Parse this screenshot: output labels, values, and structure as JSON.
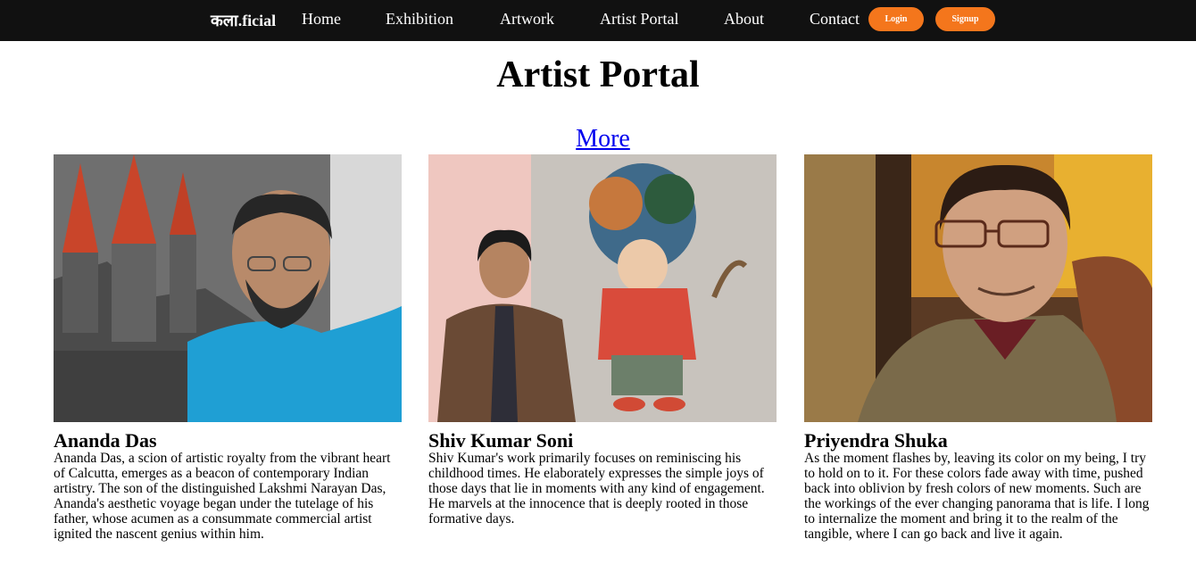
{
  "nav": {
    "brand": "कला.ficial",
    "links": [
      "Home",
      "Exhibition",
      "Artwork",
      "Artist Portal",
      "About",
      "Contact"
    ],
    "login_label": "Login",
    "signup_label": "Signup",
    "accent_color": "#f4761c"
  },
  "page": {
    "title": "Artist Portal",
    "more_label": "More"
  },
  "artists": [
    {
      "name": "Ananda Das",
      "bio": "Ananda Das, a scion of artistic royalty from the vibrant heart of Calcutta, emerges as a beacon of contemporary Indian artistry. The son of the distinguished Lakshmi Narayan Das, Ananda's aesthetic voyage began under the tutelage of his father, whose acumen as a consummate commercial artist ignited the nascent genius within him."
    },
    {
      "name": "Shiv Kumar Soni",
      "bio": "Shiv Kumar's work primarily focuses on reminiscing his childhood times. He elaborately expresses the simple joys of those days that lie in moments with any kind of engagement. He marvels at the innocence that is deeply rooted in those formative days."
    },
    {
      "name": "Priyendra Shuka",
      "bio": "As the moment flashes by, leaving its color on my being, I try to hold on to it. For these colors fade away with time, pushed back into oblivion by fresh colors of new moments. Such are the workings of the ever changing panorama that is life. I long to internalize the moment and bring it to the realm of the tangible, where I can go back and live it again."
    }
  ]
}
